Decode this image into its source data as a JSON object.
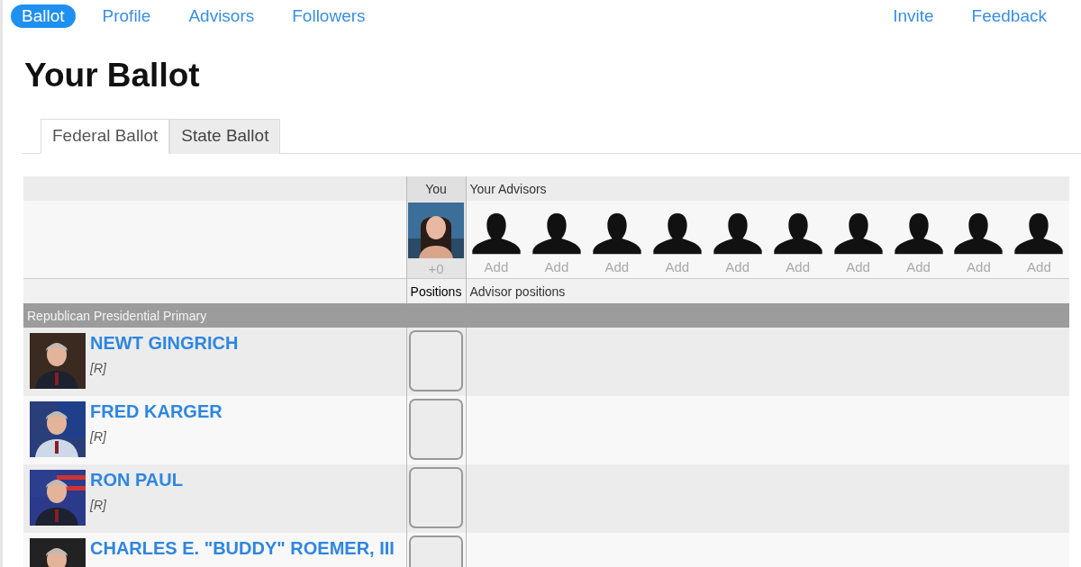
{
  "nav": {
    "items": [
      {
        "label": "Ballot",
        "selected": true
      },
      {
        "label": "Profile",
        "selected": false
      },
      {
        "label": "Advisors",
        "selected": false
      },
      {
        "label": "Followers",
        "selected": false
      }
    ],
    "right_links": [
      "Invite",
      "Feedback"
    ]
  },
  "title": "Your Ballot",
  "tabs": [
    {
      "label": "Federal Ballot",
      "selected": true
    },
    {
      "label": "State Ballot",
      "selected": false
    }
  ],
  "table": {
    "you_heading": "You",
    "advisors_heading": "Your Advisors",
    "you": {
      "count": "+0"
    },
    "advisors": [
      {
        "label": "Add"
      },
      {
        "label": "Add"
      },
      {
        "label": "Add"
      },
      {
        "label": "Add"
      },
      {
        "label": "Add"
      },
      {
        "label": "Add"
      },
      {
        "label": "Add"
      },
      {
        "label": "Add"
      },
      {
        "label": "Add"
      },
      {
        "label": "Add"
      }
    ],
    "positions_label": "Positions",
    "advisor_positions_label": "Advisor positions",
    "section": "Republican Presidential Primary",
    "candidates": [
      {
        "name": "NEWT GINGRICH",
        "party": "[R]",
        "checked": false
      },
      {
        "name": "FRED KARGER",
        "party": "[R]",
        "checked": false
      },
      {
        "name": "RON PAUL",
        "party": "[R]",
        "checked": false
      },
      {
        "name": "CHARLES E. \"BUDDY\" ROEMER, III",
        "checked": false
      }
    ]
  }
}
